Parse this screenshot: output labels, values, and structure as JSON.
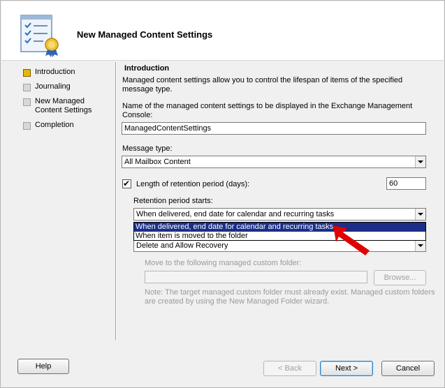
{
  "window": {
    "title": "New Managed Content Settings"
  },
  "nav": {
    "items": [
      {
        "label": "Introduction",
        "active": true
      },
      {
        "label": "Journaling",
        "active": false
      },
      {
        "label": "New Managed Content Settings",
        "active": false
      },
      {
        "label": "Completion",
        "active": false
      }
    ]
  },
  "main": {
    "section_title": "Introduction",
    "intro_line1": "Managed content settings allow you to control the lifespan of items of the specified",
    "intro_line2": "message type.",
    "name_label_line1": "Name of the managed content settings to be displayed in the Exchange Management",
    "name_label_line2": "Console:",
    "name_value": "ManagedContentSettings",
    "message_type_label": "Message type:",
    "message_type_value": "All Mailbox Content",
    "retention_checkbox_label": "Length of retention period (days):",
    "retention_checked": true,
    "retention_days": "60",
    "retention_starts_label": "Retention period starts:",
    "retention_starts_value": "When delivered, end date for calendar and recurring tasks",
    "retention_starts_options": [
      "When delivered, end date for calendar and recurring tasks",
      "When item is moved to the folder"
    ],
    "action_value": "Delete and Allow Recovery",
    "move_folder_label": "Move to the following managed custom folder:",
    "move_folder_value": "",
    "browse_label": "Browse...",
    "note_line1": "Note: The target managed custom folder must already exist. Managed custom folders",
    "note_line2": "are created by using the New Managed Folder wizard."
  },
  "footer": {
    "help_label": "Help",
    "back_label": "< Back",
    "next_label": "Next >",
    "cancel_label": "Cancel"
  },
  "colors": {
    "selection": "#1c2e88",
    "annotation_arrow": "#e00000",
    "active_bullet": "#e8b700"
  },
  "icons": {
    "wizard": "checklist-certificate-icon",
    "combo_arrow": "chevron-down-icon",
    "annotation": "red-arrow-icon"
  }
}
